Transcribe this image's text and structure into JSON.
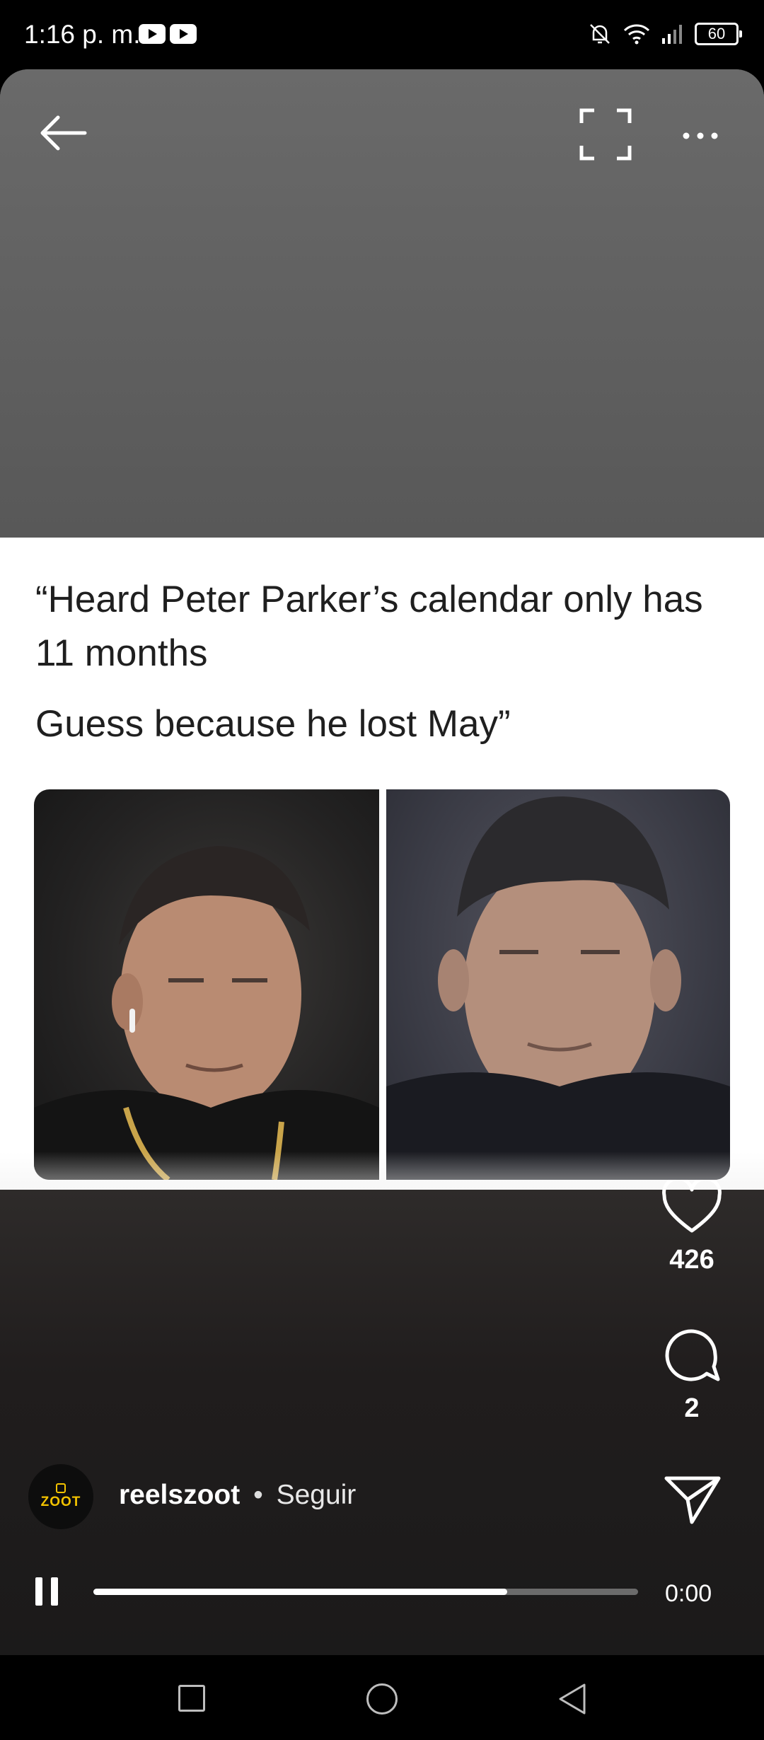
{
  "status_bar": {
    "time": "1:16 p. m.",
    "battery": "60",
    "app_icons": [
      "youtube-icon",
      "youtube-icon"
    ],
    "right_icons": [
      "mute-bell-icon",
      "wifi-icon",
      "signal-icon",
      "battery-icon"
    ]
  },
  "top_bar": {
    "back_icon": "arrow-left-icon",
    "fullscreen_icon": "fullscreen-icon",
    "more_icon": "more-horizontal-icon"
  },
  "post": {
    "caption_line1": "“Heard Peter Parker’s calendar only has 11 months",
    "caption_line2": "Guess because he lost May”"
  },
  "actions": {
    "likes": "426",
    "comments": "2",
    "like_icon": "heart-icon",
    "comment_icon": "comment-icon",
    "share_icon": "send-icon"
  },
  "account": {
    "avatar_text": "ZOOT",
    "username": "reelszoot",
    "separator": "•",
    "follow_label": "Seguir"
  },
  "playback": {
    "time": "0:00",
    "progress": 0.76,
    "pause_icon": "pause-icon"
  },
  "nav_bar": {
    "icons": [
      "recents-square-icon",
      "home-circle-icon",
      "back-triangle-icon"
    ]
  },
  "colors": {
    "accent_avatar": "#f3c300",
    "background": "#000000"
  }
}
